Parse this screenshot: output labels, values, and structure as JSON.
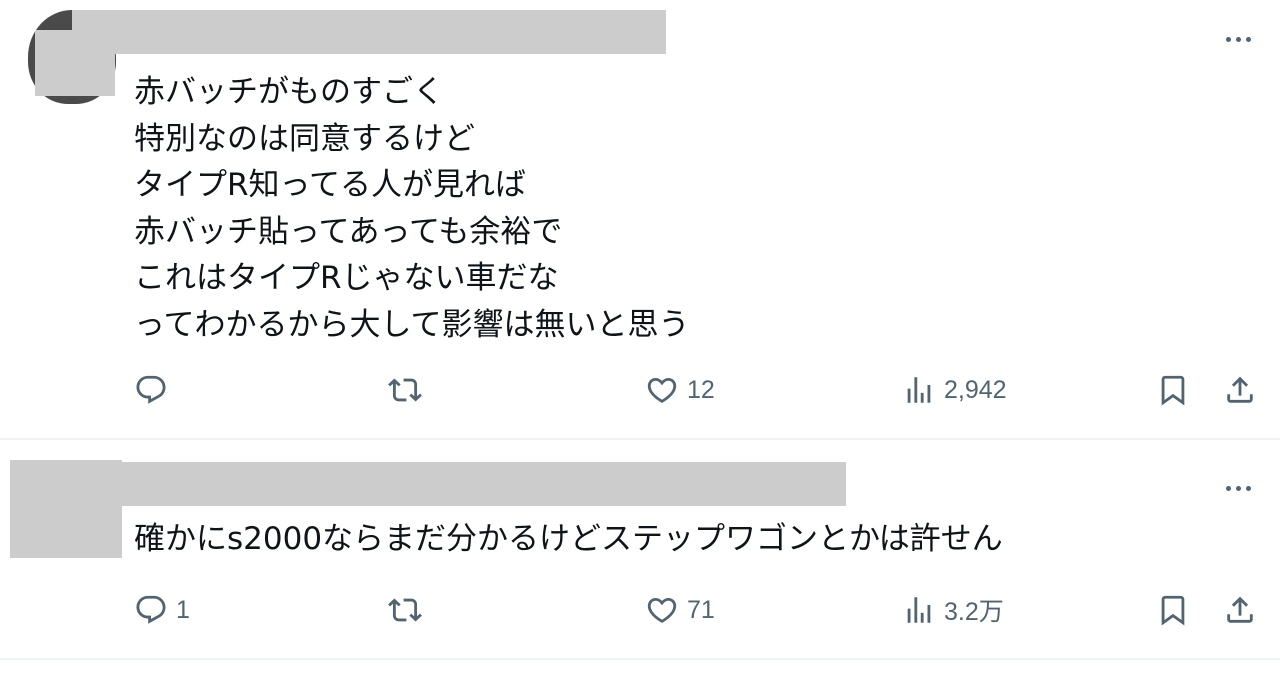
{
  "posts": [
    {
      "text": "赤バッチがものすごく\n特別なのは同意するけど\nタイプR知ってる人が見れば\n赤バッチ貼ってあっても余裕で\nこれはタイプRじゃない車だな\nってわかるから大して影響は無いと思う",
      "reply_count": "",
      "like_count": "12",
      "view_count": "2,942"
    },
    {
      "text": "確かにs2000ならまだ分かるけどステップワゴンとかは許せん",
      "reply_count": "1",
      "like_count": "71",
      "view_count": "3.2万"
    }
  ],
  "icons": {
    "more": "more-horizontal-icon",
    "reply": "reply-bubble-icon",
    "retweet": "retweet-icon",
    "like": "heart-icon",
    "views": "analytics-bars-icon",
    "bookmark": "bookmark-icon",
    "share": "share-icon"
  },
  "colors": {
    "text": "#0f1419",
    "secondary": "#536471",
    "divider": "#eff3f4",
    "redaction": "#cccccc"
  }
}
